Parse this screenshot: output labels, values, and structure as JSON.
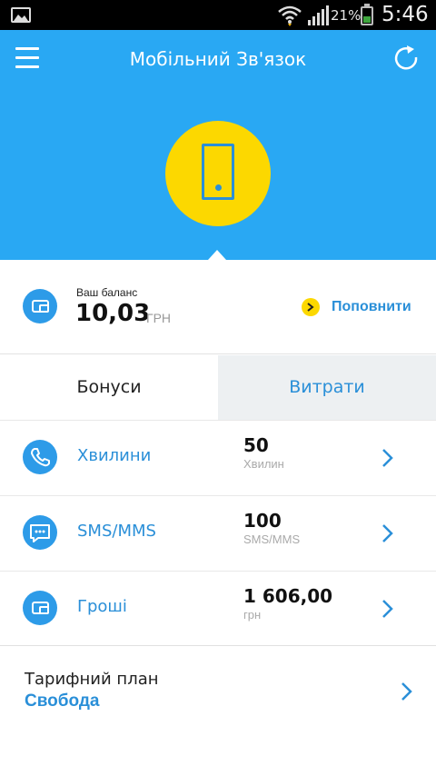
{
  "status_bar": {
    "battery_percent": "21%",
    "time": "5:46",
    "icons": [
      "gallery-icon",
      "wifi-icon",
      "signal-icon",
      "battery-icon"
    ]
  },
  "header": {
    "title": "Мобільний Зв'язок",
    "menu_icon": "hamburger-menu-icon",
    "refresh_icon": "refresh-icon",
    "hero_icon": "mobile-phone-icon"
  },
  "balance": {
    "label": "Ваш баланс",
    "value": "10,03",
    "currency": "ГРН",
    "topup_label": "Поповнити"
  },
  "tabs": [
    {
      "label": "Бонуси",
      "active": true
    },
    {
      "label": "Витрати",
      "active": false
    }
  ],
  "rows": [
    {
      "label": "Хвилини",
      "value": "50",
      "unit": "Хвилин",
      "icon": "phone-handset-icon"
    },
    {
      "label": "SMS/MMS",
      "value": "100",
      "unit": "SMS/MMS",
      "icon": "chat-bubble-icon"
    },
    {
      "label": "Гроші",
      "value": "1 606,00",
      "unit": "грн",
      "icon": "wallet-icon"
    }
  ],
  "plan": {
    "label": "Тарифний план",
    "name": "Свобода"
  },
  "colors": {
    "header_blue": "#29a8f3",
    "accent_blue": "#2a8fd8",
    "hero_yellow": "#fcd800",
    "tab_inactive_bg": "#edf0f2"
  }
}
